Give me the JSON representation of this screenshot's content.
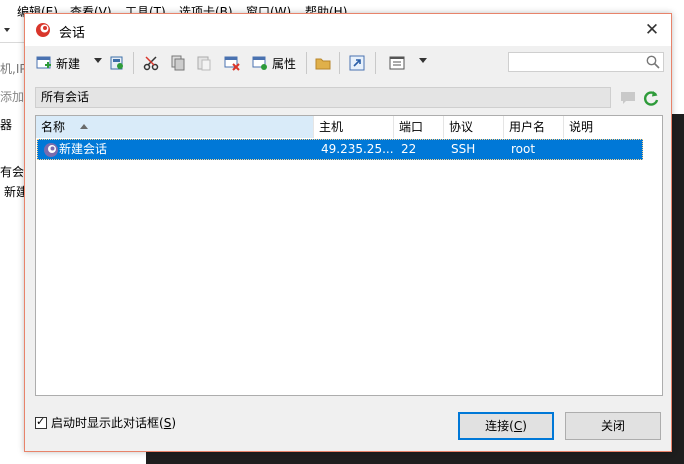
{
  "background_app": {
    "menu": [
      "编辑(E)",
      "查看(V)",
      "工具(T)",
      "选项卡(B)",
      "窗口(W)",
      "帮助(H)"
    ],
    "left_fragments": [
      "机,IP",
      "添加当",
      "器",
      "有会",
      "新建"
    ]
  },
  "dialog": {
    "title": "会话",
    "close_glyph": "✕",
    "toolbar": {
      "new_label": "新建",
      "properties_label": "属性"
    },
    "search": {
      "value": "",
      "placeholder": ""
    },
    "path": "所有会话",
    "table": {
      "columns": [
        "名称",
        "主机",
        "端口",
        "协议",
        "用户名",
        "说明"
      ],
      "sorted_column": "名称",
      "rows": [
        {
          "name": "新建会话",
          "host": "49.235.25...",
          "port": "22",
          "protocol": "SSH",
          "user": "root",
          "description": ""
        }
      ]
    },
    "show_on_startup": {
      "label": "启动时显示此对话框",
      "accel": "S",
      "checked": true
    },
    "connect_button": {
      "label": "连接",
      "accel": "C"
    },
    "close_button": {
      "label": "关闭"
    }
  },
  "colors": {
    "selection": "#0078d7",
    "dialog_border": "#e8836a",
    "brand_red": "#d9362b"
  }
}
